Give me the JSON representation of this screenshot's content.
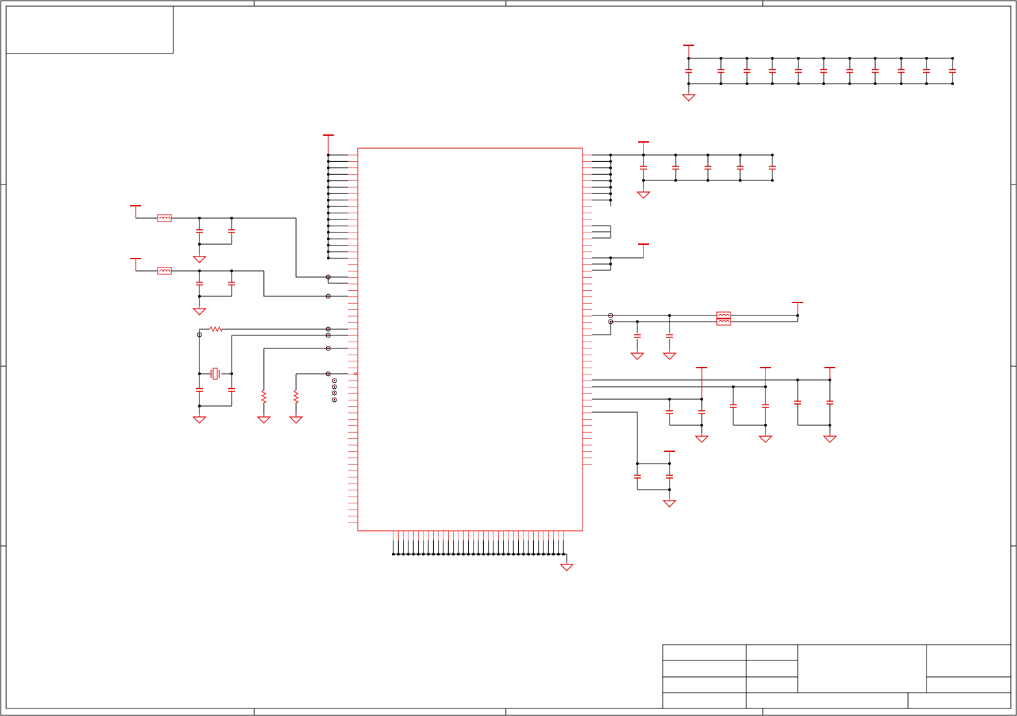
{
  "schematic": {
    "title_block_text": [],
    "colors": {
      "component": "#e00000",
      "wire": "#000000",
      "junction": "#000000",
      "frame": "#000000",
      "background": "#ffffff"
    },
    "component_counts": {
      "ic": 1,
      "inductors": 3,
      "capacitors": 36,
      "resistors": 3,
      "crystals": 1,
      "power_symbols": 11,
      "ground_symbols": 15
    }
  }
}
